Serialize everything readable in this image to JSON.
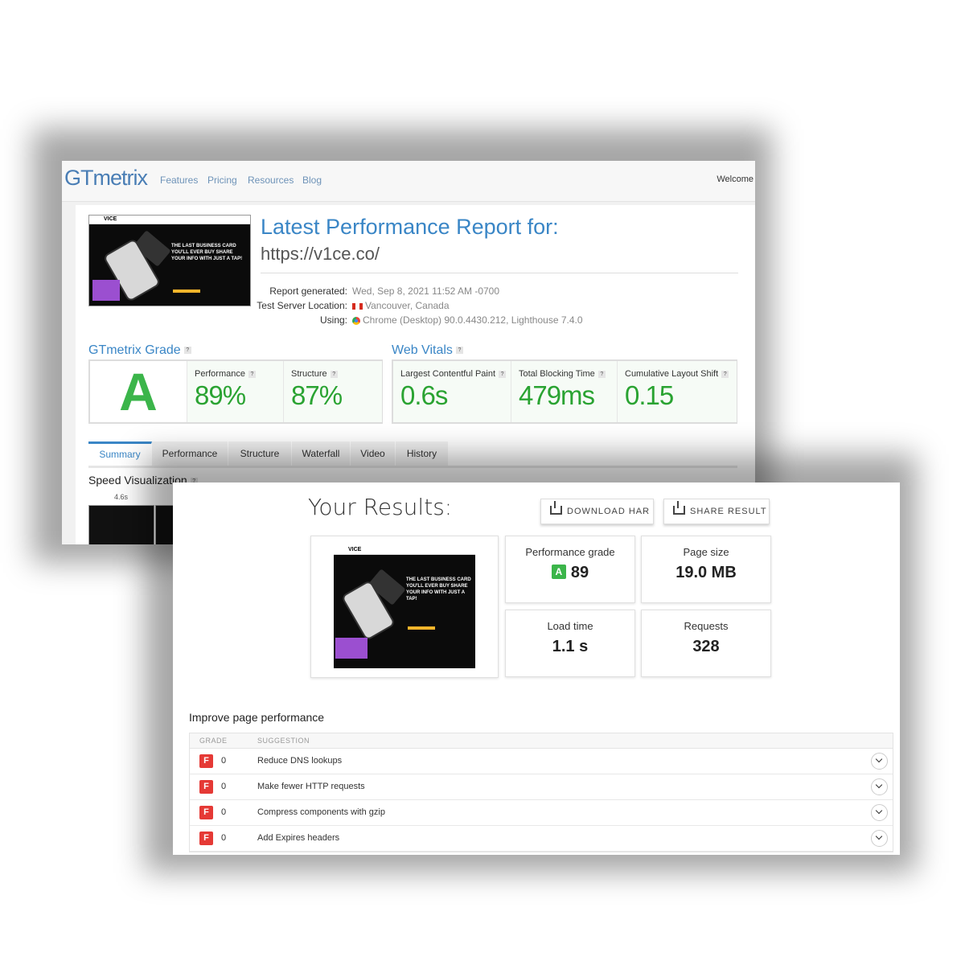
{
  "gtmetrix": {
    "logo": "GTmetrix",
    "nav": [
      "Features",
      "Pricing",
      "Resources",
      "Blog"
    ],
    "welcome": "Welcome",
    "report_title": "Latest Performance Report for:",
    "url": "https://v1ce.co/",
    "meta": {
      "generated_label": "Report generated:",
      "generated_value": "Wed, Sep 8, 2021 11:52 AM -0700",
      "location_label": "Test Server Location:",
      "location_value": "Vancouver, Canada",
      "using_label": "Using:",
      "using_value": "Chrome (Desktop) 90.0.4430.212, Lighthouse 7.4.0"
    },
    "grade_section": "GTmetrix Grade",
    "grade": "A",
    "performance_label": "Performance",
    "performance_value": "89%",
    "structure_label": "Structure",
    "structure_value": "87%",
    "web_vitals_section": "Web Vitals",
    "lcp_label": "Largest Contentful Paint",
    "lcp_value": "0.6s",
    "tbt_label": "Total Blocking Time",
    "tbt_value": "479ms",
    "cls_label": "Cumulative Layout Shift",
    "cls_value": "0.15",
    "tabs": [
      "Summary",
      "Performance",
      "Structure",
      "Waterfall",
      "Video",
      "History"
    ],
    "speed_viz": "Speed Visualization",
    "speed_time": "4.6s",
    "thumb_logo": "VICE",
    "thumb_text": "THE LAST BUSINESS CARD YOU'LL EVER BUY  SHARE YOUR INFO WITH JUST A TAP!"
  },
  "results": {
    "title": "Your Results:",
    "download_btn": "DOWNLOAD HAR",
    "share_btn": "SHARE RESULT",
    "perf_grade_label": "Performance grade",
    "perf_grade_letter": "A",
    "perf_grade_value": "89",
    "page_size_label": "Page size",
    "page_size_value": "19.0 MB",
    "load_time_label": "Load time",
    "load_time_value": "1.1 s",
    "requests_label": "Requests",
    "requests_value": "328",
    "improve_title": "Improve page performance",
    "col_grade": "GRADE",
    "col_suggestion": "SUGGESTION",
    "rows": [
      {
        "grade": "F",
        "score": "0",
        "suggestion": "Reduce DNS lookups"
      },
      {
        "grade": "F",
        "score": "0",
        "suggestion": "Make fewer HTTP requests"
      },
      {
        "grade": "F",
        "score": "0",
        "suggestion": "Compress components with gzip"
      },
      {
        "grade": "F",
        "score": "0",
        "suggestion": "Add Expires headers"
      }
    ]
  },
  "colors": {
    "accent": "#3a86c6",
    "good": "#2aa332",
    "bad": "#e53935"
  }
}
